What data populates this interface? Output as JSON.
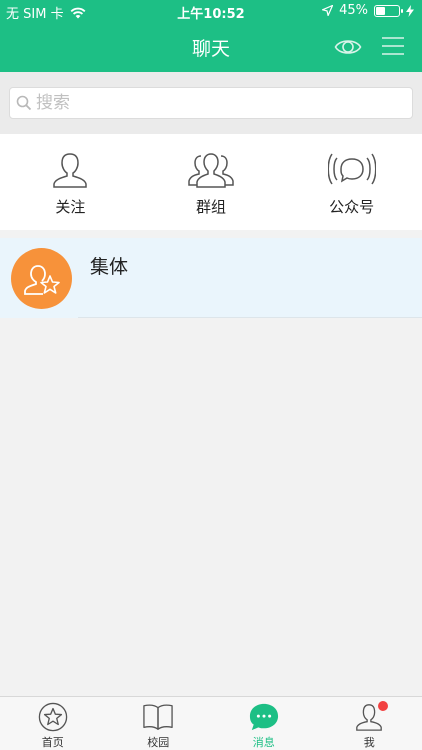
{
  "status_bar": {
    "carrier": "无 SIM 卡",
    "time": "上午10:52",
    "battery_percent": "45%",
    "battery_level": 0.45
  },
  "nav": {
    "title": "聊天",
    "eye_icon": "eye-icon",
    "menu_icon": "menu-icon"
  },
  "search": {
    "placeholder": "搜索",
    "value": ""
  },
  "quick_actions": [
    {
      "label": "关注",
      "icon": "person-icon"
    },
    {
      "label": "群组",
      "icon": "group-icon"
    },
    {
      "label": "公众号",
      "icon": "broadcast-icon"
    }
  ],
  "conversations": [
    {
      "name": "集体",
      "avatar_icon": "person-star-icon",
      "avatar_color": "#f7923a"
    }
  ],
  "tabs": [
    {
      "label": "首页",
      "icon": "star-icon",
      "active": false
    },
    {
      "label": "校园",
      "icon": "book-icon",
      "active": false
    },
    {
      "label": "消息",
      "icon": "chat-bubble-icon",
      "active": true
    },
    {
      "label": "我",
      "icon": "person-icon",
      "active": false,
      "badge": true
    }
  ],
  "colors": {
    "brand_green": "#1dbf85",
    "avatar_orange": "#f7923a",
    "badge_red": "#f24141",
    "selected_row": "#eaf5fc"
  }
}
